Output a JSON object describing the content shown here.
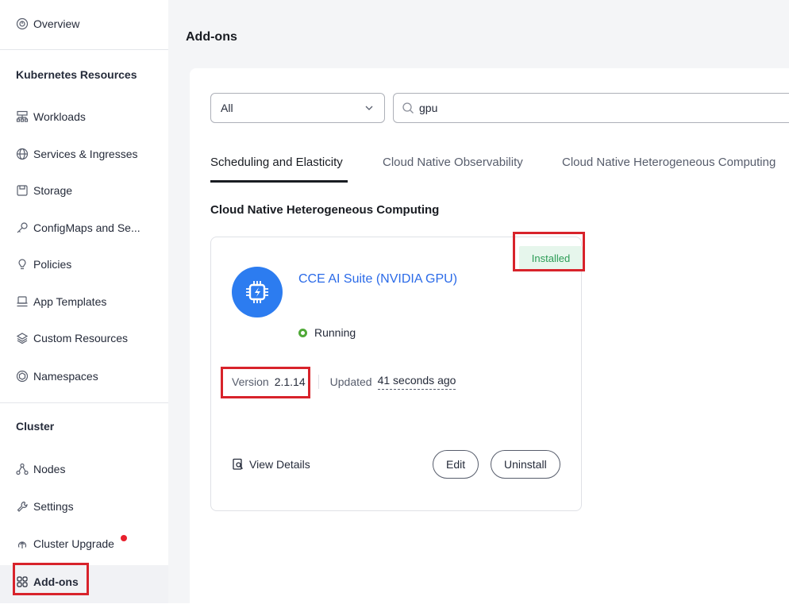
{
  "sidebar": {
    "overview": "Overview",
    "k8s_section": "Kubernetes Resources",
    "items": [
      {
        "label": "Workloads",
        "icon": "workloads-icon"
      },
      {
        "label": "Services & Ingresses",
        "icon": "globe-icon"
      },
      {
        "label": "Storage",
        "icon": "storage-icon"
      },
      {
        "label": "ConfigMaps and Se...",
        "icon": "key-icon"
      },
      {
        "label": "Policies",
        "icon": "policy-icon"
      },
      {
        "label": "App Templates",
        "icon": "template-icon"
      },
      {
        "label": "Custom Resources",
        "icon": "layers-icon"
      },
      {
        "label": "Namespaces",
        "icon": "cube-icon"
      }
    ],
    "cluster_section": "Cluster",
    "cluster_items": [
      {
        "label": "Nodes",
        "icon": "nodes-icon"
      },
      {
        "label": "Settings",
        "icon": "wrench-icon"
      },
      {
        "label": "Cluster Upgrade",
        "icon": "upgrade-icon",
        "badge_dot": true
      },
      {
        "label": "Add-ons",
        "icon": "addons-icon",
        "active": true
      }
    ]
  },
  "main": {
    "title": "Add-ons",
    "filter": {
      "selected": "All"
    },
    "search": {
      "value": "gpu"
    },
    "tabs": [
      {
        "label": "Scheduling and Elasticity",
        "active": true
      },
      {
        "label": "Cloud Native Observability"
      },
      {
        "label": "Cloud Native Heterogeneous Computing"
      }
    ],
    "section_title": "Cloud Native Heterogeneous Computing",
    "card": {
      "status_tag": "Installed",
      "name": "CCE AI Suite (NVIDIA GPU)",
      "status": "Running",
      "version_label": "Version",
      "version": "2.1.14",
      "updated_label": "Updated",
      "updated": "41 seconds ago",
      "view_details": "View Details",
      "edit": "Edit",
      "uninstall": "Uninstall"
    }
  },
  "colors": {
    "accent": "#2a6ae8",
    "installed_bg": "#e6f6ec",
    "installed_text": "#2c9c56",
    "running": "#50a938",
    "highlight": "#d8232b",
    "badge": "#e8202d"
  }
}
